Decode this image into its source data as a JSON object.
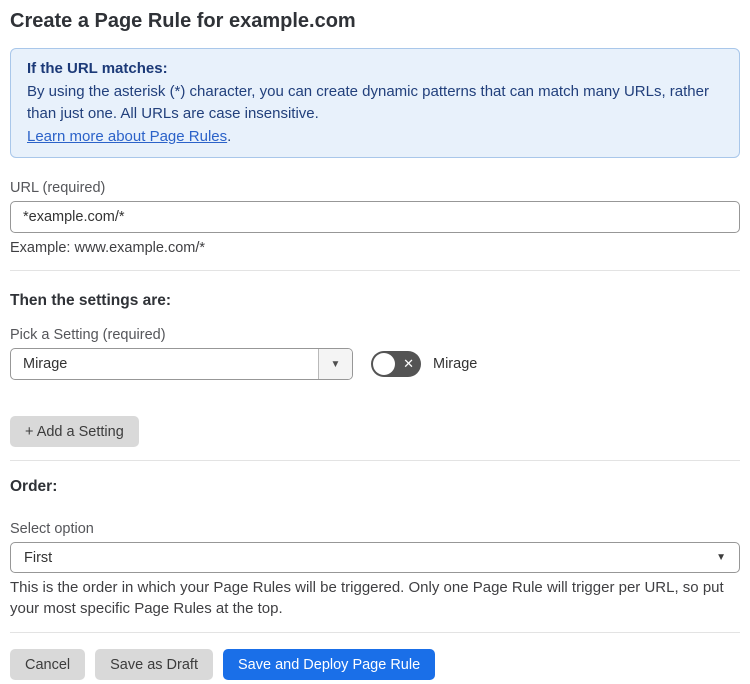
{
  "page": {
    "title": "Create a Page Rule for example.com"
  },
  "info_box": {
    "heading": "If the URL matches:",
    "body": "By using the asterisk (*) character, you can create dynamic patterns that can match many URLs, rather than just one. All URLs are case insensitive.",
    "link_label": "Learn more about Page Rules",
    "link_suffix": "."
  },
  "url_field": {
    "label": "URL (required)",
    "value": "*example.com/*",
    "example": "Example: www.example.com/*"
  },
  "settings_section": {
    "heading": "Then the settings are:",
    "picker_label": "Pick a Setting (required)",
    "picker_value": "Mirage",
    "picker_arrow": "▼",
    "toggle_state": "off",
    "toggle_glyph": "✕",
    "toggle_label": "Mirage",
    "add_button_label": "+ Add a Setting"
  },
  "order_section": {
    "heading": "Order:",
    "select_label": "Select option",
    "select_value": "First",
    "select_arrow": "▼",
    "help_text": "This is the order in which your Page Rules will be triggered. Only one Page Rule will trigger per URL, so put your most specific Page Rules at the top."
  },
  "footer": {
    "cancel_label": "Cancel",
    "save_draft_label": "Save as Draft",
    "save_deploy_label": "Save and Deploy Page Rule"
  },
  "colors": {
    "info_bg": "#e8f1fb",
    "info_border": "#a9c7ea",
    "info_text": "#22407c",
    "link": "#2b62c9",
    "primary_button": "#1a6fe8",
    "toggle_off": "#545454"
  }
}
